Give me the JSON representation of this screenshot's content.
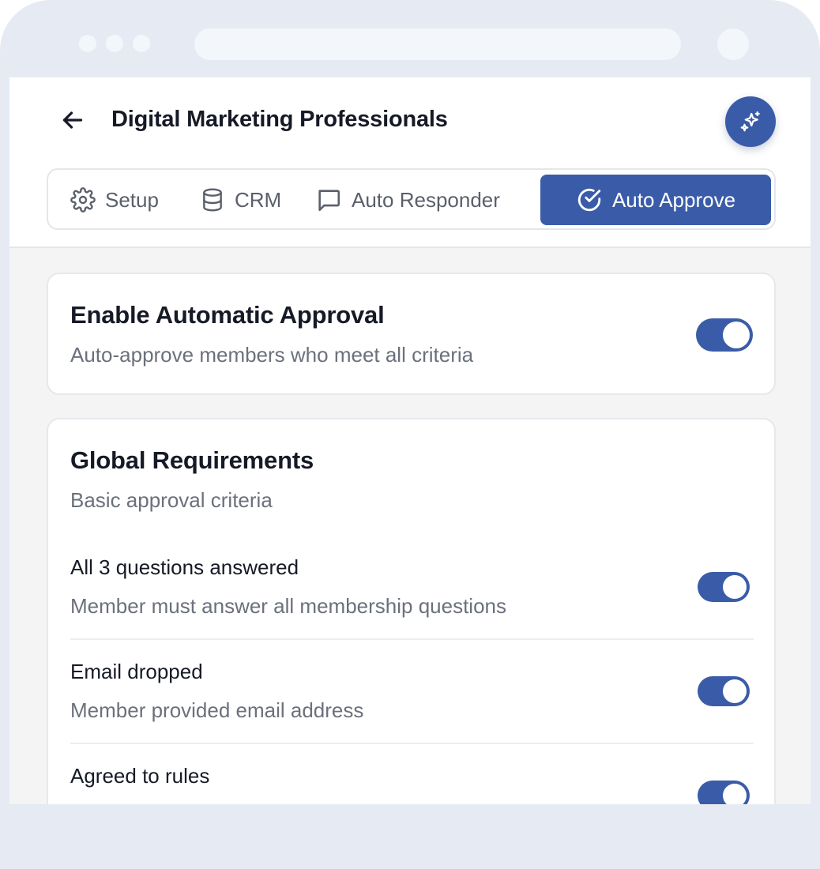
{
  "header": {
    "title": "Digital Marketing Professionals"
  },
  "tabs": [
    {
      "label": "Setup",
      "icon": "gear-icon",
      "active": false
    },
    {
      "label": "CRM",
      "icon": "database-icon",
      "active": false
    },
    {
      "label": "Auto Responder",
      "icon": "chat-bubble-icon",
      "active": false
    },
    {
      "label": "Auto Approve",
      "icon": "check-circle-icon",
      "active": true
    }
  ],
  "enable_card": {
    "title": "Enable Automatic Approval",
    "subtitle": "Auto-approve members who meet all criteria",
    "enabled": true
  },
  "global_requirements": {
    "title": "Global Requirements",
    "subtitle": "Basic approval criteria",
    "items": [
      {
        "title": "All 3 questions answered",
        "subtitle": "Member must answer all membership questions",
        "enabled": true
      },
      {
        "title": "Email dropped",
        "subtitle": "Member provided email address",
        "enabled": true
      },
      {
        "title": "Agreed to rules",
        "subtitle": "",
        "enabled": true
      }
    ]
  },
  "colors": {
    "accent": "#3a5ca8",
    "background": "#f4f4f5",
    "frame": "#e6ebf3"
  }
}
